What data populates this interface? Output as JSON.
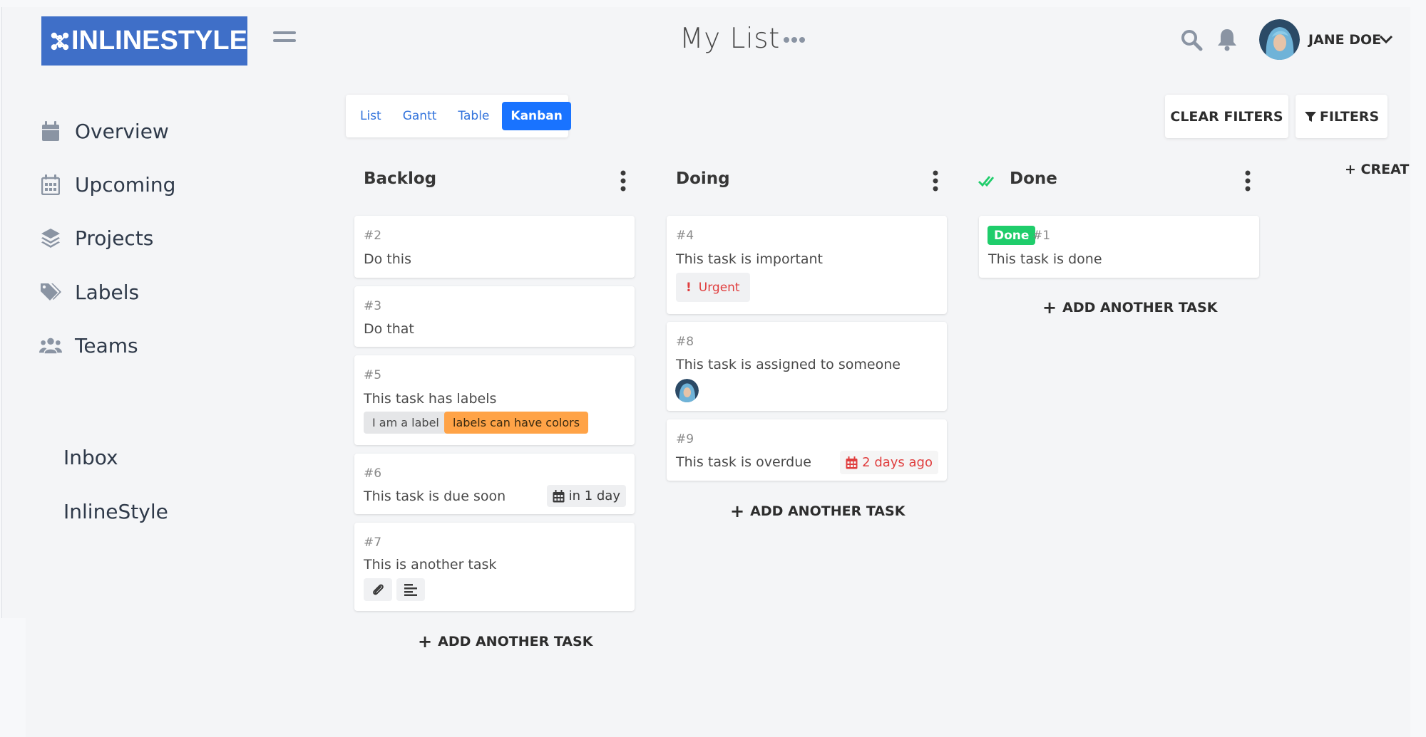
{
  "brand": {
    "name": "INLINESTYLE"
  },
  "sidebar": {
    "nav": [
      {
        "label": "Overview",
        "icon": "calendar-icon"
      },
      {
        "label": "Upcoming",
        "icon": "calendar-grid-icon"
      },
      {
        "label": "Projects",
        "icon": "layers-icon"
      },
      {
        "label": "Labels",
        "icon": "tags-icon"
      },
      {
        "label": "Teams",
        "icon": "users-icon"
      }
    ],
    "projects": [
      "Inbox",
      "InlineStyle"
    ]
  },
  "header": {
    "title": "My List",
    "user": "JANE DOE"
  },
  "views": {
    "items": [
      "List",
      "Gantt",
      "Table",
      "Kanban"
    ],
    "active": "Kanban"
  },
  "toolbar": {
    "clear_filters": "CLEAR FILTERS",
    "filters": "FILTERS",
    "create_bucket": "+ CREATE"
  },
  "buckets": [
    {
      "title": "Backlog",
      "add_label": "ADD ANOTHER TASK",
      "tasks": [
        {
          "id": "#2",
          "title": "Do this"
        },
        {
          "id": "#3",
          "title": "Do that"
        },
        {
          "id": "#5",
          "title": "This task has labels",
          "labels": [
            "I am a label",
            "labels can have colors"
          ]
        },
        {
          "id": "#6",
          "title": "This task is due soon",
          "due": "in 1 day"
        },
        {
          "id": "#7",
          "title": "This is another task"
        }
      ]
    },
    {
      "title": "Doing",
      "add_label": "ADD ANOTHER TASK",
      "tasks": [
        {
          "id": "#4",
          "title": "This task is important",
          "priority": "Urgent"
        },
        {
          "id": "#8",
          "title": "This task is assigned to someone"
        },
        {
          "id": "#9",
          "title": "This task is overdue",
          "due": "2 days ago"
        }
      ]
    },
    {
      "title": "Done",
      "add_label": "ADD ANOTHER TASK",
      "tasks": [
        {
          "id": "#1",
          "title": "This task is done",
          "badge": "Done"
        }
      ]
    }
  ],
  "colors": {
    "brand": "#3f6fc8",
    "accent": "#1973ff",
    "done": "#1fcd6b",
    "urgent": "#e03e3e",
    "label_orange": "#ffa347"
  }
}
